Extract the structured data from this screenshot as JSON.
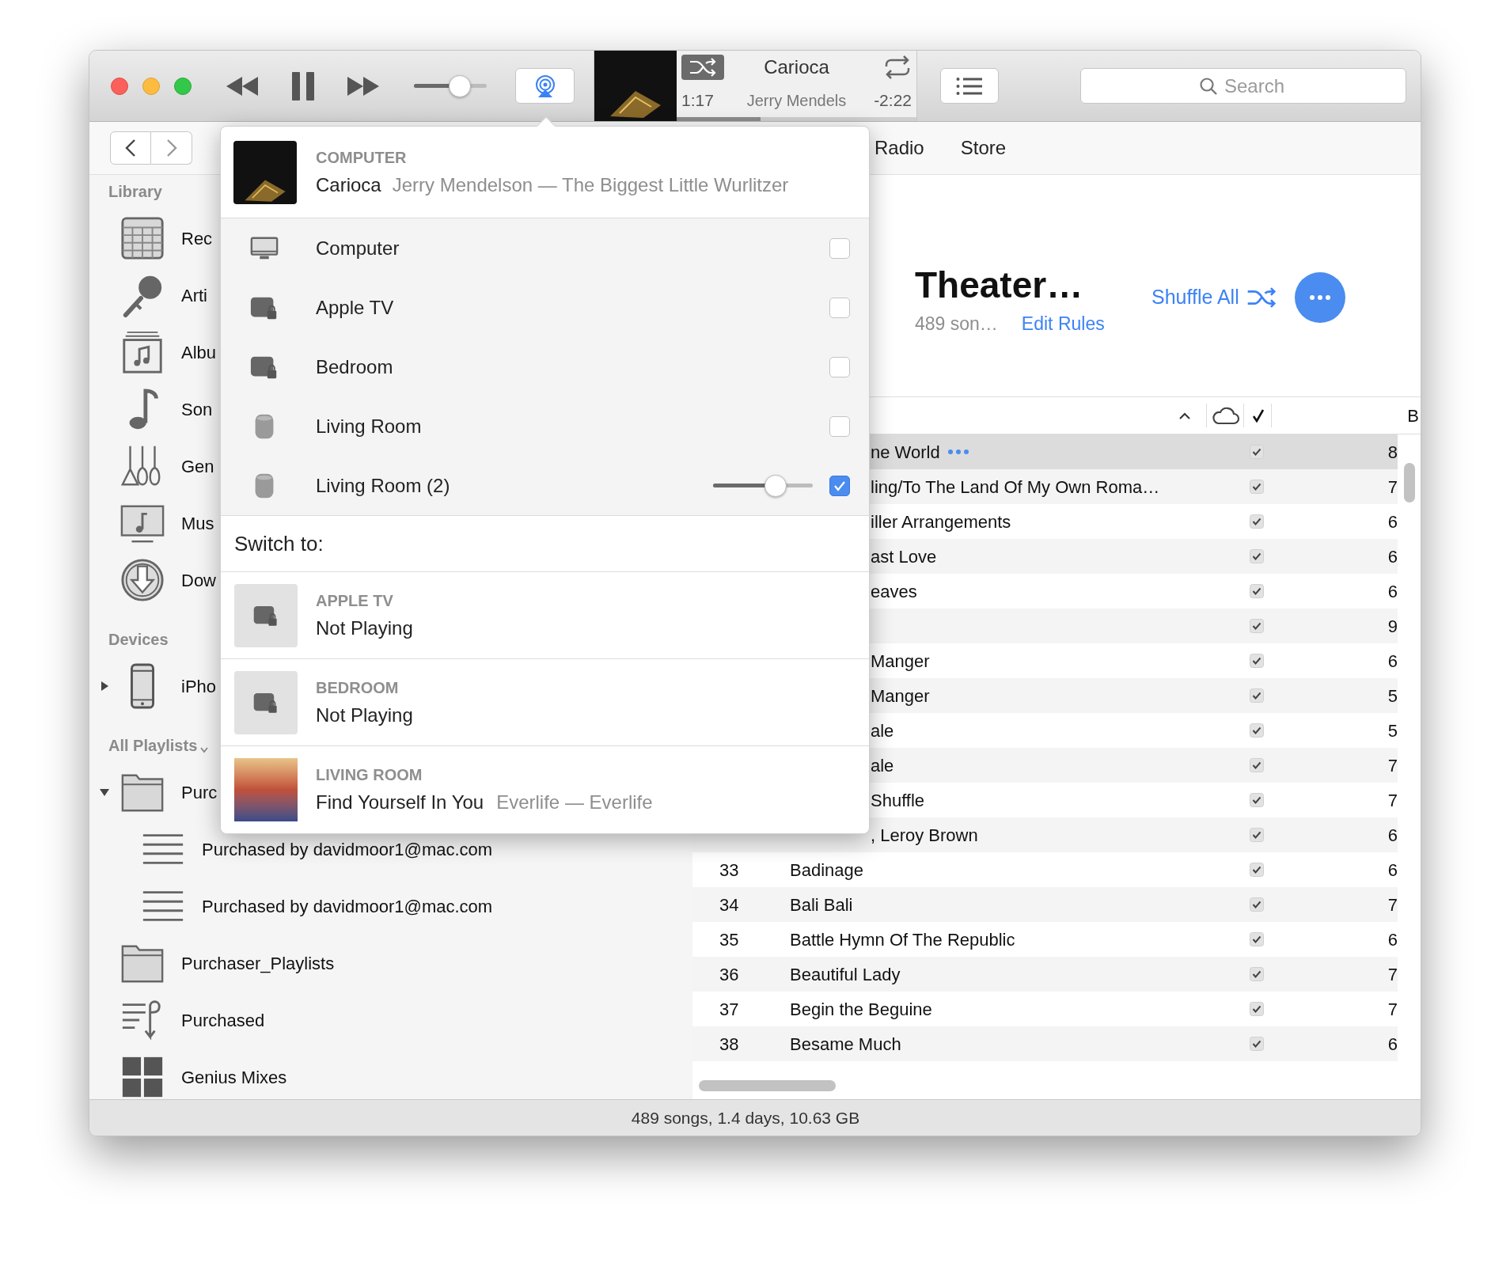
{
  "player": {
    "volume": {
      "level": 0.63
    }
  },
  "now_playing": {
    "title": "Carioca",
    "artist": "Jerry Mendels",
    "elapsed": "1:17",
    "remaining": "-2:22",
    "progress": {
      "level": 0.35
    }
  },
  "search": {
    "placeholder": "Search"
  },
  "nav_tabs": [
    {
      "label": "Radio",
      "selected": false
    },
    {
      "label": "Store",
      "selected": false
    }
  ],
  "sidebar": {
    "sections": [
      {
        "title": "Library",
        "items": [
          {
            "label": "Rec",
            "kind": "calendar"
          },
          {
            "label": "Arti",
            "kind": "microphone"
          },
          {
            "label": "Albu",
            "kind": "album"
          },
          {
            "label": "Son",
            "kind": "note"
          },
          {
            "label": "Gen",
            "kind": "guitars"
          },
          {
            "label": "Mus",
            "kind": "monitor"
          },
          {
            "label": "Dow",
            "kind": "download"
          }
        ]
      },
      {
        "title": "Devices",
        "items": [
          {
            "label": "iPho",
            "kind": "phone",
            "expanded": false
          }
        ]
      },
      {
        "title": "All Playlists",
        "has_menu": true,
        "items": [
          {
            "label": "Purc",
            "kind": "folder",
            "expanded": true,
            "children": [
              {
                "label": "Purchased by davidmoor1@mac.com",
                "kind": "list"
              },
              {
                "label": "Purchased by davidmoor1@mac.com",
                "kind": "list"
              }
            ]
          },
          {
            "label": "Purchaser_Playlists",
            "kind": "folder"
          },
          {
            "label": "Purchased",
            "kind": "purchased"
          },
          {
            "label": "Genius Mixes",
            "kind": "grid"
          }
        ]
      }
    ]
  },
  "playlist": {
    "title": "Theater…",
    "count": "489 son…",
    "edit_rules": "Edit Rules",
    "shuffle_all": "Shuffle All"
  },
  "table": {
    "column_4": "B",
    "rows": [
      {
        "name": "ne World",
        "checked": true,
        "selected": true,
        "column_4": "8"
      },
      {
        "name": "ling/To The Land Of My Own Roma…",
        "checked": true,
        "selected": false,
        "column_4": "7"
      },
      {
        "name": "iller Arrangements",
        "checked": true,
        "selected": false,
        "column_4": "6"
      },
      {
        "name": "ast Love",
        "checked": true,
        "selected": false,
        "column_4": "6"
      },
      {
        "name": "eaves",
        "checked": true,
        "selected": false,
        "column_4": "6"
      },
      {
        "checked": true,
        "selected": false,
        "column_4": "9"
      },
      {
        "name": "Manger",
        "checked": true,
        "selected": false,
        "column_4": "6"
      },
      {
        "name": "Manger",
        "checked": true,
        "selected": false,
        "column_4": "5"
      },
      {
        "name": "ale",
        "checked": true,
        "selected": false,
        "column_4": "5"
      },
      {
        "name": "ale",
        "checked": true,
        "selected": false,
        "column_4": "7"
      },
      {
        "name": "Shuffle",
        "checked": true,
        "selected": false,
        "column_4": "7"
      },
      {
        "name": ", Leroy Brown",
        "checked": true,
        "selected": false,
        "column_4": "6"
      },
      {
        "number": "33",
        "name": "Badinage",
        "checked": true,
        "selected": false,
        "column_4": "6"
      },
      {
        "number": "34",
        "name": "Bali Bali",
        "checked": true,
        "selected": false,
        "column_4": "7"
      },
      {
        "number": "35",
        "name": "Battle Hymn Of The Republic",
        "checked": true,
        "selected": false,
        "column_4": "6"
      },
      {
        "number": "36",
        "name": "Beautiful Lady",
        "checked": true,
        "selected": false,
        "column_4": "7"
      },
      {
        "number": "37",
        "name": "Begin the Beguine",
        "checked": true,
        "selected": false,
        "column_4": "7"
      },
      {
        "number": "38",
        "name": "Besame Much",
        "checked": true,
        "selected": false,
        "column_4": "6"
      }
    ]
  },
  "status_bar": "489 songs, 1.4 days, 10.63 GB",
  "airplay_popover": {
    "current": {
      "source": "COMPUTER",
      "title": "Carioca",
      "subtitle": "Jerry Mendelson — The Biggest Little Wurlitzer"
    },
    "devices": [
      {
        "name": "Computer",
        "kind": "computer",
        "checked": false
      },
      {
        "name": "Apple TV",
        "kind": "appletv",
        "checked": false
      },
      {
        "name": "Bedroom",
        "kind": "appletv",
        "checked": false
      },
      {
        "name": "Living Room",
        "kind": "speaker",
        "checked": false
      },
      {
        "name": "Living Room (2)",
        "kind": "speaker",
        "checked": true,
        "volume": {
          "level": 0.63
        }
      }
    ],
    "switch_heading": "Switch to:",
    "switch_targets": [
      {
        "device": "APPLE TV",
        "title": "Not Playing",
        "kind": "appletv"
      },
      {
        "device": "BEDROOM",
        "title": "Not Playing",
        "kind": "appletv"
      },
      {
        "device": "LIVING ROOM",
        "title": "Find Yourself In You",
        "subtitle": "Everlife — Everlife",
        "kind": "album"
      }
    ]
  }
}
